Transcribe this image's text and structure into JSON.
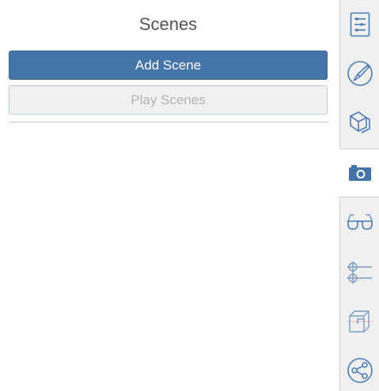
{
  "panel": {
    "title": "Scenes",
    "add_scene_label": "Add Scene",
    "play_scenes_label": "Play Scenes"
  },
  "sidebar": {
    "tabs": [
      {
        "icon": "model-tree-icon",
        "active": false
      },
      {
        "icon": "paint-brush-icon",
        "active": false
      },
      {
        "icon": "layers-icon",
        "active": false
      },
      {
        "icon": "camera-icon",
        "active": true
      },
      {
        "icon": "glasses-icon",
        "active": false
      },
      {
        "icon": "section-planes-icon",
        "active": false
      },
      {
        "icon": "explode-box-icon",
        "active": false
      },
      {
        "icon": "share-icon",
        "active": false
      }
    ]
  },
  "colors": {
    "primary_button": "#4474a8",
    "icon_blue": "#4a7bb7",
    "icon_light_blue": "#7a9cc6"
  }
}
